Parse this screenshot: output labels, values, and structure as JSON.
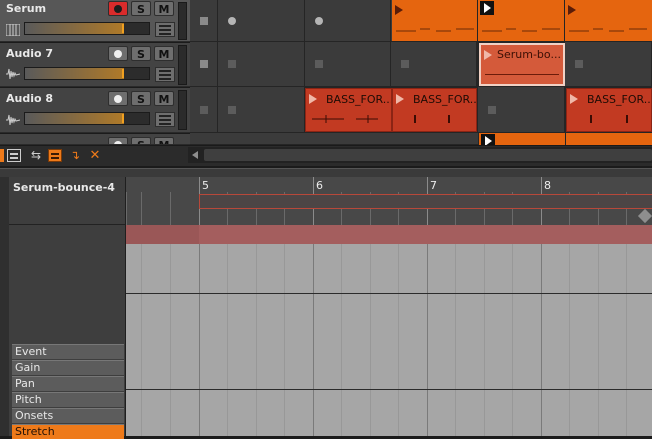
{
  "tracks": [
    {
      "name": "Serum",
      "icon": "piano-icon",
      "armed": true
    },
    {
      "name": "Audio 7",
      "icon": "waveform-icon",
      "armed": false
    },
    {
      "name": "Audio 8",
      "icon": "waveform-icon",
      "armed": false
    }
  ],
  "buttons": {
    "solo": "S",
    "mute": "M"
  },
  "clips": {
    "serum_bounce": "Serum-bo...",
    "bass_1": "BASS_FOR...",
    "bass_2": "BASS_FOR...",
    "bass_3": "BASS_FOR..."
  },
  "editor": {
    "clip_title": "Serum-bounce-4",
    "ruler_numbers": [
      "5",
      "6",
      "7",
      "8"
    ],
    "properties": [
      "Event",
      "Gain",
      "Pan",
      "Pitch",
      "Onsets",
      "Stretch"
    ],
    "active_property": "Stretch"
  },
  "colors": {
    "orange_clip": "#e5650f",
    "red_clip": "#c23a22",
    "record_active": "#d92b2b",
    "accent": "#ee7a1a"
  }
}
